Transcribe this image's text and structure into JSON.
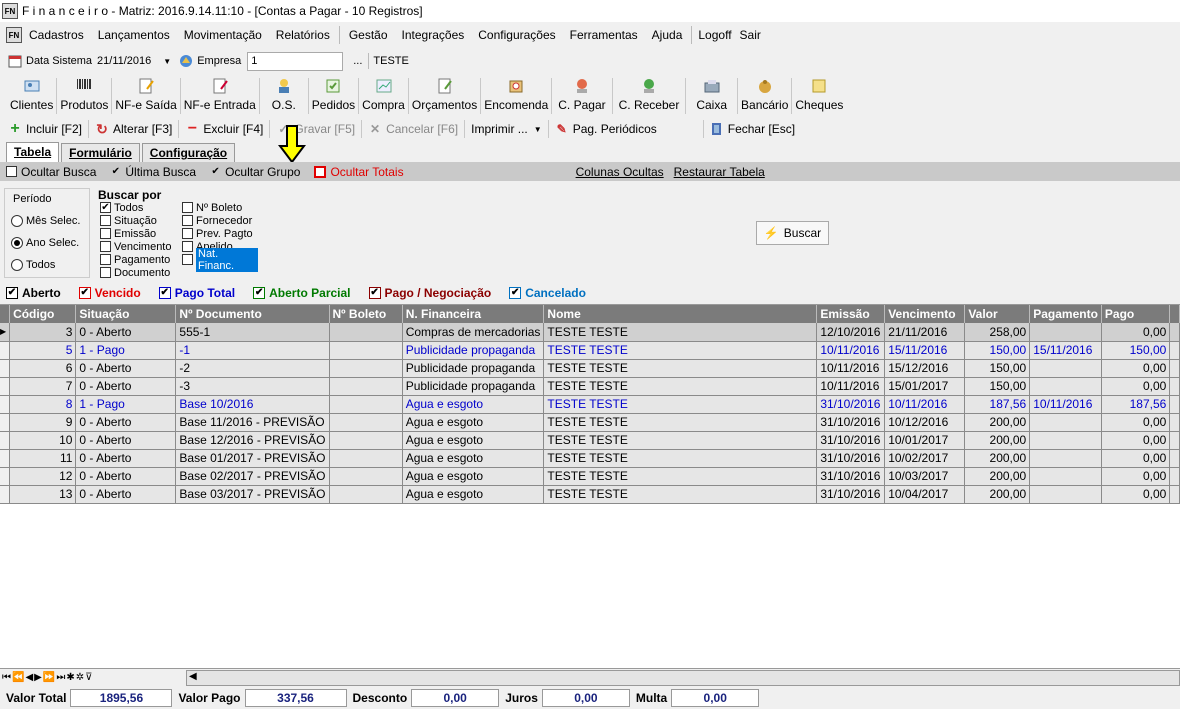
{
  "window": {
    "title": "F i n a n c e i r o - Matriz: 2016.9.14.11:10 - [Contas a Pagar - 10 Registros]",
    "app_icon": "FN"
  },
  "menu": [
    "Cadastros",
    "Lançamentos",
    "Movimentação",
    "Relatórios",
    "Gestão",
    "Integrações",
    "Configurações",
    "Ferramentas",
    "Ajuda",
    "Logoff",
    "Sair"
  ],
  "system": {
    "data_label": "Data Sistema",
    "data_value": "21/11/2016",
    "empresa_label": "Empresa",
    "empresa_value": "1",
    "ellipsis": "...",
    "empresa_name": "TESTE"
  },
  "toolbar": [
    {
      "label": "Clientes",
      "icon": "clients-icon"
    },
    {
      "label": "Produtos",
      "icon": "barcode-icon"
    },
    {
      "label": "NF-e Saída",
      "icon": "invoice-out-icon"
    },
    {
      "label": "NF-e Entrada",
      "icon": "invoice-in-icon"
    },
    {
      "label": "O.S.",
      "icon": "service-order-icon"
    },
    {
      "label": "Pedidos",
      "icon": "orders-icon"
    },
    {
      "label": "Compra",
      "icon": "purchase-icon"
    },
    {
      "label": "Orçamentos",
      "icon": "quotes-icon"
    },
    {
      "label": "Encomenda",
      "icon": "package-icon"
    },
    {
      "label": "C. Pagar",
      "icon": "payable-icon"
    },
    {
      "label": "C. Receber",
      "icon": "receivable-icon"
    },
    {
      "label": "Caixa",
      "icon": "cashbox-icon"
    },
    {
      "label": "Bancário",
      "icon": "bank-icon"
    },
    {
      "label": "Cheques",
      "icon": "checks-icon"
    }
  ],
  "actions": {
    "incluir": "Incluir [F2]",
    "alterar": "Alterar [F3]",
    "excluir": "Excluir [F4]",
    "gravar": "Gravar [F5]",
    "cancelar": "Cancelar [F6]",
    "imprimir": "Imprimir ...",
    "periodicos": "Pag. Periódicos",
    "fechar": "Fechar [Esc]"
  },
  "tabs": [
    "Tabela",
    "Formulário",
    "Configuração"
  ],
  "options": {
    "ocultar_busca": "Ocultar Busca",
    "ultima_busca": "Última Busca",
    "ocultar_grupo": "Ocultar Grupo",
    "ocultar_totais": "Ocultar Totais",
    "colunas_ocultas": "Colunas Ocultas",
    "restaurar_tabela": "Restaurar Tabela"
  },
  "periodo": {
    "title": "Período",
    "options": [
      "Mês Selec.",
      "Ano Selec.",
      "Todos"
    ],
    "selected": 1
  },
  "buscar_por": {
    "title": "Buscar por",
    "col1": [
      "Todos",
      "Situação",
      "Emissão",
      "Vencimento",
      "Pagamento",
      "Documento"
    ],
    "col2": [
      "Nº Boleto",
      "Fornecedor",
      "Prev. Pagto",
      "Apelido",
      "Nat. Financ."
    ],
    "button": "Buscar"
  },
  "legend": [
    {
      "label": "Aberto",
      "color": "#000000"
    },
    {
      "label": "Vencido",
      "color": "#e00000"
    },
    {
      "label": "Pago Total",
      "color": "#0000cc"
    },
    {
      "label": "Aberto Parcial",
      "color": "#007a00"
    },
    {
      "label": "Pago / Negociação",
      "color": "#8b0000"
    },
    {
      "label": "Cancelado",
      "color": "#0070c0"
    }
  ],
  "columns": [
    "Código",
    "Situação",
    "Nº Documento",
    "Nº Boleto",
    "N. Financeira",
    "Nome",
    "Emissão",
    "Vencimento",
    "Valor",
    "Pagamento",
    "Pago"
  ],
  "rows": [
    {
      "codigo": "3",
      "situacao": "0 - Aberto",
      "documento": "555-1",
      "boleto": "",
      "financeira": "Compras de mercadorias",
      "nome": "TESTE TESTE",
      "emissao": "12/10/2016",
      "vencimento": "21/11/2016",
      "valor": "258,00",
      "pagamento": "",
      "pago": "0,00",
      "pagoTotal": false
    },
    {
      "codigo": "5",
      "situacao": "1 - Pago",
      "documento": "-1",
      "boleto": "",
      "financeira": "Publicidade propaganda",
      "nome": "TESTE TESTE",
      "emissao": "10/11/2016",
      "vencimento": "15/11/2016",
      "valor": "150,00",
      "pagamento": "15/11/2016",
      "pago": "150,00",
      "pagoTotal": true
    },
    {
      "codigo": "6",
      "situacao": "0 - Aberto",
      "documento": "-2",
      "boleto": "",
      "financeira": "Publicidade propaganda",
      "nome": "TESTE TESTE",
      "emissao": "10/11/2016",
      "vencimento": "15/12/2016",
      "valor": "150,00",
      "pagamento": "",
      "pago": "0,00",
      "pagoTotal": false
    },
    {
      "codigo": "7",
      "situacao": "0 - Aberto",
      "documento": "-3",
      "boleto": "",
      "financeira": "Publicidade propaganda",
      "nome": "TESTE TESTE",
      "emissao": "10/11/2016",
      "vencimento": "15/01/2017",
      "valor": "150,00",
      "pagamento": "",
      "pago": "0,00",
      "pagoTotal": false
    },
    {
      "codigo": "8",
      "situacao": "1 - Pago",
      "documento": "Base 10/2016",
      "boleto": "",
      "financeira": "Agua e esgoto",
      "nome": "TESTE TESTE",
      "emissao": "31/10/2016",
      "vencimento": "10/11/2016",
      "valor": "187,56",
      "pagamento": "10/11/2016",
      "pago": "187,56",
      "pagoTotal": true
    },
    {
      "codigo": "9",
      "situacao": "0 - Aberto",
      "documento": "Base 11/2016 - PREVISÃO",
      "boleto": "",
      "financeira": "Agua e esgoto",
      "nome": "TESTE TESTE",
      "emissao": "31/10/2016",
      "vencimento": "10/12/2016",
      "valor": "200,00",
      "pagamento": "",
      "pago": "0,00",
      "pagoTotal": false
    },
    {
      "codigo": "10",
      "situacao": "0 - Aberto",
      "documento": "Base 12/2016 - PREVISÃO",
      "boleto": "",
      "financeira": "Agua e esgoto",
      "nome": "TESTE TESTE",
      "emissao": "31/10/2016",
      "vencimento": "10/01/2017",
      "valor": "200,00",
      "pagamento": "",
      "pago": "0,00",
      "pagoTotal": false
    },
    {
      "codigo": "11",
      "situacao": "0 - Aberto",
      "documento": "Base 01/2017 - PREVISÃO",
      "boleto": "",
      "financeira": "Agua e esgoto",
      "nome": "TESTE TESTE",
      "emissao": "31/10/2016",
      "vencimento": "10/02/2017",
      "valor": "200,00",
      "pagamento": "",
      "pago": "0,00",
      "pagoTotal": false
    },
    {
      "codigo": "12",
      "situacao": "0 - Aberto",
      "documento": "Base 02/2017 - PREVISÃO",
      "boleto": "",
      "financeira": "Agua e esgoto",
      "nome": "TESTE TESTE",
      "emissao": "31/10/2016",
      "vencimento": "10/03/2017",
      "valor": "200,00",
      "pagamento": "",
      "pago": "0,00",
      "pagoTotal": false
    },
    {
      "codigo": "13",
      "situacao": "0 - Aberto",
      "documento": "Base 03/2017 - PREVISÃO",
      "boleto": "",
      "financeira": "Agua e esgoto",
      "nome": "TESTE TESTE",
      "emissao": "31/10/2016",
      "vencimento": "10/04/2017",
      "valor": "200,00",
      "pagamento": "",
      "pago": "0,00",
      "pagoTotal": false
    }
  ],
  "totals": {
    "valor_total_label": "Valor Total",
    "valor_total": "1895,56",
    "valor_pago_label": "Valor Pago",
    "valor_pago": "337,56",
    "desconto_label": "Desconto",
    "desconto": "0,00",
    "juros_label": "Juros",
    "juros": "0,00",
    "multa_label": "Multa",
    "multa": "0,00"
  },
  "colors": {
    "pago_total_row": "#0000cc",
    "header_bg": "#7b7b7b",
    "annotation_arrow": "#ffff00"
  }
}
